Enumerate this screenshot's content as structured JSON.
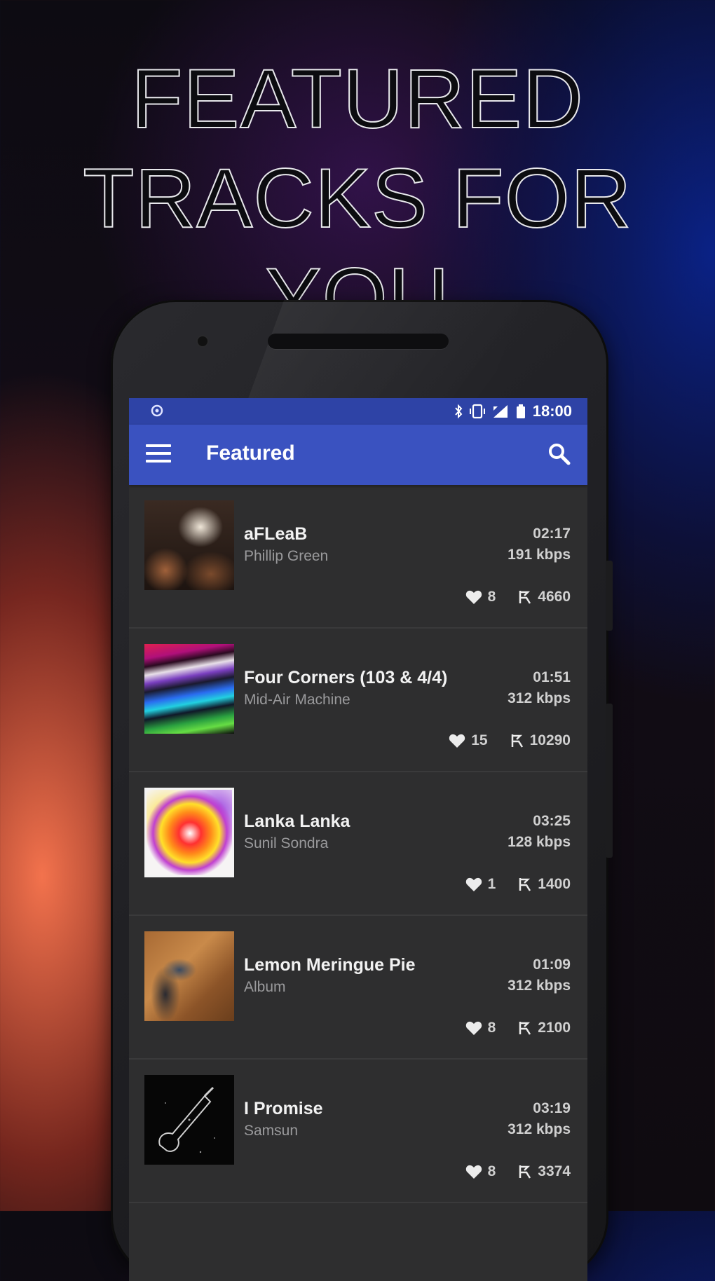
{
  "headline": {
    "line1": "FEATURED",
    "line2": "TRACKS FOR YOU"
  },
  "status_bar": {
    "time": "18:00"
  },
  "app_bar": {
    "title": "Featured"
  },
  "colors": {
    "status_bar": "#2e43a6",
    "app_bar": "#3a52c0",
    "list_background": "#2e2e2f"
  },
  "tracks": [
    {
      "title": "aFLeaB",
      "artist": "Phillip Green",
      "duration": "02:17",
      "bitrate": "191 kbps",
      "likes": "8",
      "plays": "4660"
    },
    {
      "title": "Four Corners (103 & 4/4)",
      "artist": "Mid-Air Machine",
      "duration": "01:51",
      "bitrate": "312 kbps",
      "likes": "15",
      "plays": "10290"
    },
    {
      "title": "Lanka Lanka",
      "artist": "Sunil Sondra",
      "duration": "03:25",
      "bitrate": "128 kbps",
      "likes": "1",
      "plays": "1400"
    },
    {
      "title": "Lemon Meringue Pie",
      "artist": "Album",
      "duration": "01:09",
      "bitrate": "312 kbps",
      "likes": "8",
      "plays": "2100"
    },
    {
      "title": "I Promise",
      "artist": "Samsun",
      "duration": "03:19",
      "bitrate": "312 kbps",
      "likes": "8",
      "plays": "3374"
    }
  ]
}
